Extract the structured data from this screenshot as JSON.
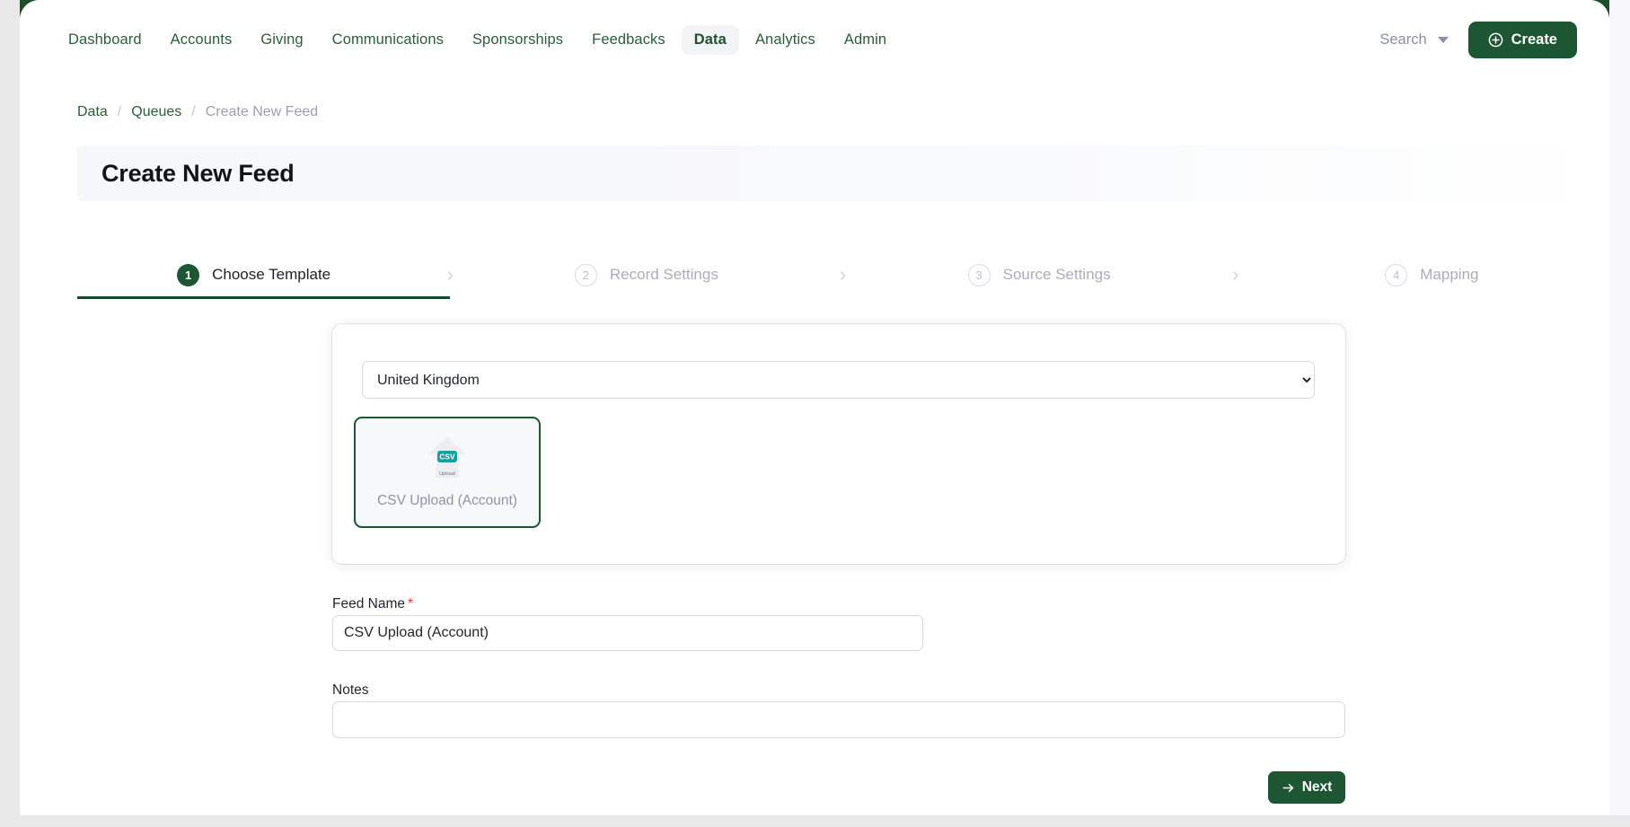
{
  "nav": {
    "items": [
      {
        "label": "Dashboard",
        "active": false
      },
      {
        "label": "Accounts",
        "active": false
      },
      {
        "label": "Giving",
        "active": false
      },
      {
        "label": "Communications",
        "active": false
      },
      {
        "label": "Sponsorships",
        "active": false
      },
      {
        "label": "Feedbacks",
        "active": false
      },
      {
        "label": "Data",
        "active": true
      },
      {
        "label": "Analytics",
        "active": false
      },
      {
        "label": "Admin",
        "active": false
      }
    ],
    "search_label": "Search",
    "create_label": "Create"
  },
  "breadcrumb": {
    "items": [
      "Data",
      "Queues",
      "Create New Feed"
    ],
    "separator": "/"
  },
  "header": {
    "title": "Create New Feed"
  },
  "stepper": {
    "steps": [
      {
        "number": "1",
        "label": "Choose Template",
        "active": true
      },
      {
        "number": "2",
        "label": "Record Settings",
        "active": false
      },
      {
        "number": "3",
        "label": "Source Settings",
        "active": false
      },
      {
        "number": "4",
        "label": "Mapping",
        "active": false
      }
    ],
    "chevron": "›"
  },
  "template_card": {
    "country_select": {
      "value": "United Kingdom",
      "options": [
        "United Kingdom"
      ]
    },
    "tiles": [
      {
        "caption": "CSV Upload (Account)",
        "icon_badge": "CSV",
        "icon_sublabel": "Upload",
        "selected": true
      }
    ]
  },
  "form": {
    "feed_name": {
      "label": "Feed Name",
      "required_marker": "*",
      "value": "CSV Upload (Account)",
      "placeholder": ""
    },
    "notes": {
      "label": "Notes",
      "value": "",
      "placeholder": ""
    }
  },
  "footer": {
    "next_label": "Next"
  },
  "colors": {
    "brand_green": "#1d5632",
    "dark_green_backdrop": "#1d4d2b",
    "accent_teal": "#12a0a0",
    "required_red": "#e0393e",
    "muted_text": "#8e94a6"
  }
}
